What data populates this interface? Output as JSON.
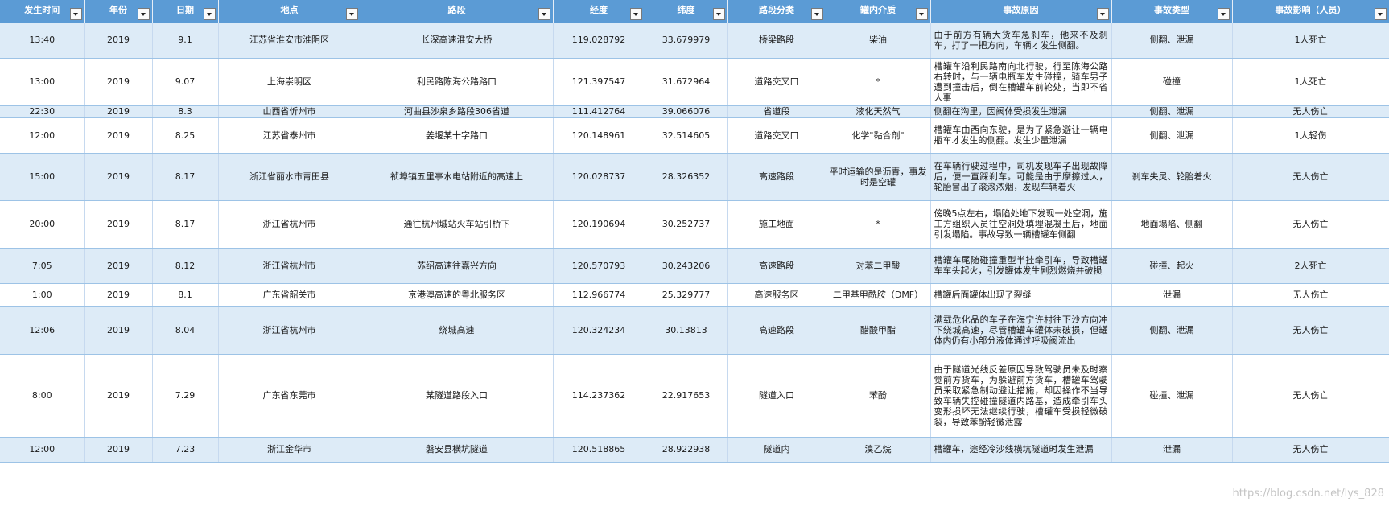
{
  "columns": [
    {
      "label": "发生时间"
    },
    {
      "label": "年份"
    },
    {
      "label": "日期"
    },
    {
      "label": "地点"
    },
    {
      "label": "路段"
    },
    {
      "label": "经度"
    },
    {
      "label": "纬度"
    },
    {
      "label": "路段分类"
    },
    {
      "label": "罐内介质"
    },
    {
      "label": "事故原因"
    },
    {
      "label": "事故类型"
    },
    {
      "label": "事故影响（人员）"
    }
  ],
  "rows": [
    {
      "cells": [
        "13:40",
        "2019",
        "9.1",
        "江苏省淮安市淮阴区",
        "长深高速淮安大桥",
        "119.028792",
        "33.679979",
        "桥梁路段",
        "柴油",
        "由于前方有辆大货车急刹车，他来不及刹车，打了一把方向，车辆才发生侧翻。",
        "侧翻、泄漏",
        "1人死亡"
      ]
    },
    {
      "cells": [
        "13:00",
        "2019",
        "9.07",
        "上海崇明区",
        "利民路陈海公路路口",
        "121.397547",
        "31.672964",
        "道路交叉口",
        "*",
        "槽罐车沿利民路南向北行驶，行至陈海公路右转时，与一辆电瓶车发生碰撞，骑车男子遭到撞击后，倒在槽罐车前轮处，当即不省人事",
        "碰撞",
        "1人死亡"
      ]
    },
    {
      "cells": [
        "22:30",
        "2019",
        "8.3",
        "山西省忻州市",
        "河曲县沙泉乡路段306省道",
        "111.412764",
        "39.066076",
        "省道段",
        "液化天然气",
        "侧翻在沟里，因阀体受损发生泄漏",
        "侧翻、泄漏",
        "无人伤亡"
      ]
    },
    {
      "cells": [
        "12:00",
        "2019",
        "8.25",
        "江苏省泰州市",
        "姜堰某十字路口",
        "120.148961",
        "32.514605",
        "道路交叉口",
        "化学\"黏合剂\"",
        "槽罐车由西向东驶，是为了紧急避让一辆电瓶车才发生的侧翻。发生少量泄漏",
        "侧翻、泄漏",
        "1人轻伤"
      ]
    },
    {
      "cells": [
        "15:00",
        "2019",
        "8.17",
        "浙江省丽水市青田县",
        "祯埠镇五里亭水电站附近的高速上",
        "120.028737",
        "28.326352",
        "高速路段",
        "平时运输的是沥青，事发时是空罐",
        "在车辆行驶过程中，司机发现车子出现故障后，便一直踩刹车。可能是由于摩擦过大，轮胎冒出了滚滚浓烟，发现车辆着火",
        "刹车失灵、轮胎着火",
        "无人伤亡"
      ]
    },
    {
      "cells": [
        "20:00",
        "2019",
        "8.17",
        "浙江省杭州市",
        "通往杭州城站火车站引桥下",
        "120.190694",
        "30.252737",
        "施工地面",
        "*",
        "傍晚5点左右，塌陷处地下发现一处空洞，施工方组织人员往空洞处填埋混凝土后，地面引发塌陷。事故导致一辆槽罐车侧翻",
        "地面塌陷、侧翻",
        "无人伤亡"
      ]
    },
    {
      "cells": [
        "7:05",
        "2019",
        "8.12",
        "浙江省杭州市",
        "苏绍高速往嘉兴方向",
        "120.570793",
        "30.243206",
        "高速路段",
        "对苯二甲酸",
        "槽罐车尾随碰撞重型半挂牵引车，导致槽罐车车头起火，引发罐体发生剧烈燃烧并破损",
        "碰撞、起火",
        "2人死亡"
      ]
    },
    {
      "cells": [
        "1:00",
        "2019",
        "8.1",
        "广东省韶关市",
        "京港澳高速的粤北服务区",
        "112.966774",
        "25.329777",
        "高速服务区",
        "二甲基甲酰胺（DMF）",
        "槽罐后面罐体出现了裂缝",
        "泄漏",
        "无人伤亡"
      ]
    },
    {
      "cells": [
        "12:06",
        "2019",
        "8.04",
        "浙江省杭州市",
        "绕城高速",
        "120.324234",
        "30.13813",
        "高速路段",
        "醋酸甲酯",
        "满载危化品的车子在海宁许村往下沙方向冲下绕城高速，尽管槽罐车罐体未破损，但罐体内仍有小部分液体通过呼吸阀流出",
        "侧翻、泄漏",
        "无人伤亡"
      ]
    },
    {
      "cells": [
        "8:00",
        "2019",
        "7.29",
        "广东省东莞市",
        "某隧道路段入口",
        "114.237362",
        "22.917653",
        "隧道入口",
        "苯酚",
        "由于隧道光线反差原因导致驾驶员未及时察觉前方货车，为躲避前方货车，槽罐车驾驶员采取紧急制动避让措施，却因操作不当导致车辆失控碰撞隧道内路基，造成牵引车头变形损坏无法继续行驶，槽罐车受损轻微破裂，导致苯酚轻微泄露",
        "碰撞、泄漏",
        "无人伤亡"
      ]
    },
    {
      "cells": [
        "12:00",
        "2019",
        "7.23",
        "浙江金华市",
        "磐安县横坑隧道",
        "120.518865",
        "28.922938",
        "隧道内",
        "溴乙烷",
        "槽罐车，途经冷沙线横坑隧道时发生泄漏",
        "泄漏",
        "无人伤亡"
      ]
    }
  ],
  "watermark": "https://blog.csdn.net/lys_828"
}
